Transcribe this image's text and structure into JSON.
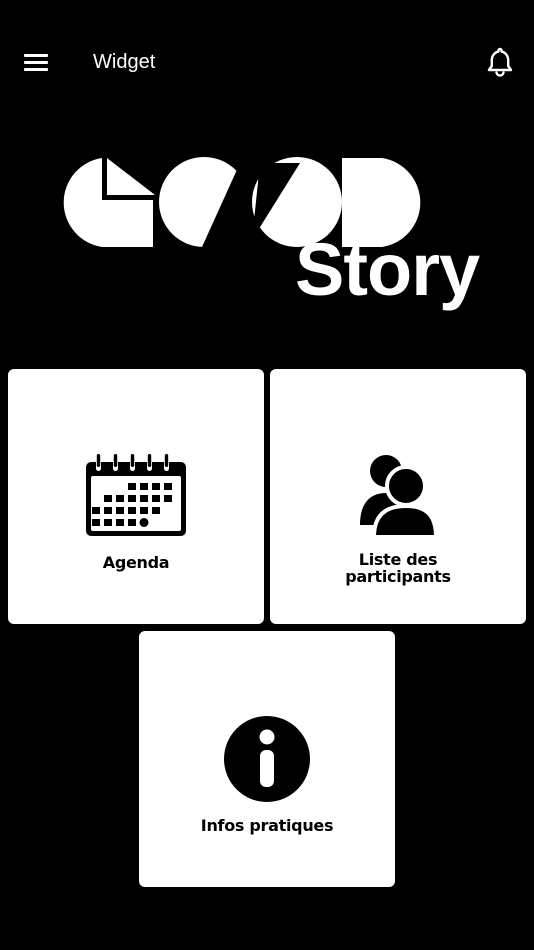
{
  "header": {
    "title": "Widget",
    "menu_icon": "hamburger-menu-icon",
    "notifications_icon": "bell-icon"
  },
  "logo": {
    "top_text": "GOOD",
    "bottom_text": "Story"
  },
  "tiles": [
    {
      "label": "Agenda",
      "icon": "calendar-icon"
    },
    {
      "label_line1": "Liste des",
      "label_line2": "participants",
      "icon": "participants-icon"
    },
    {
      "label": "Infos pratiques",
      "icon": "info-icon"
    }
  ],
  "colors": {
    "background": "#000000",
    "tile_background": "#ffffff",
    "foreground": "#ffffff",
    "icon_color": "#000000"
  }
}
